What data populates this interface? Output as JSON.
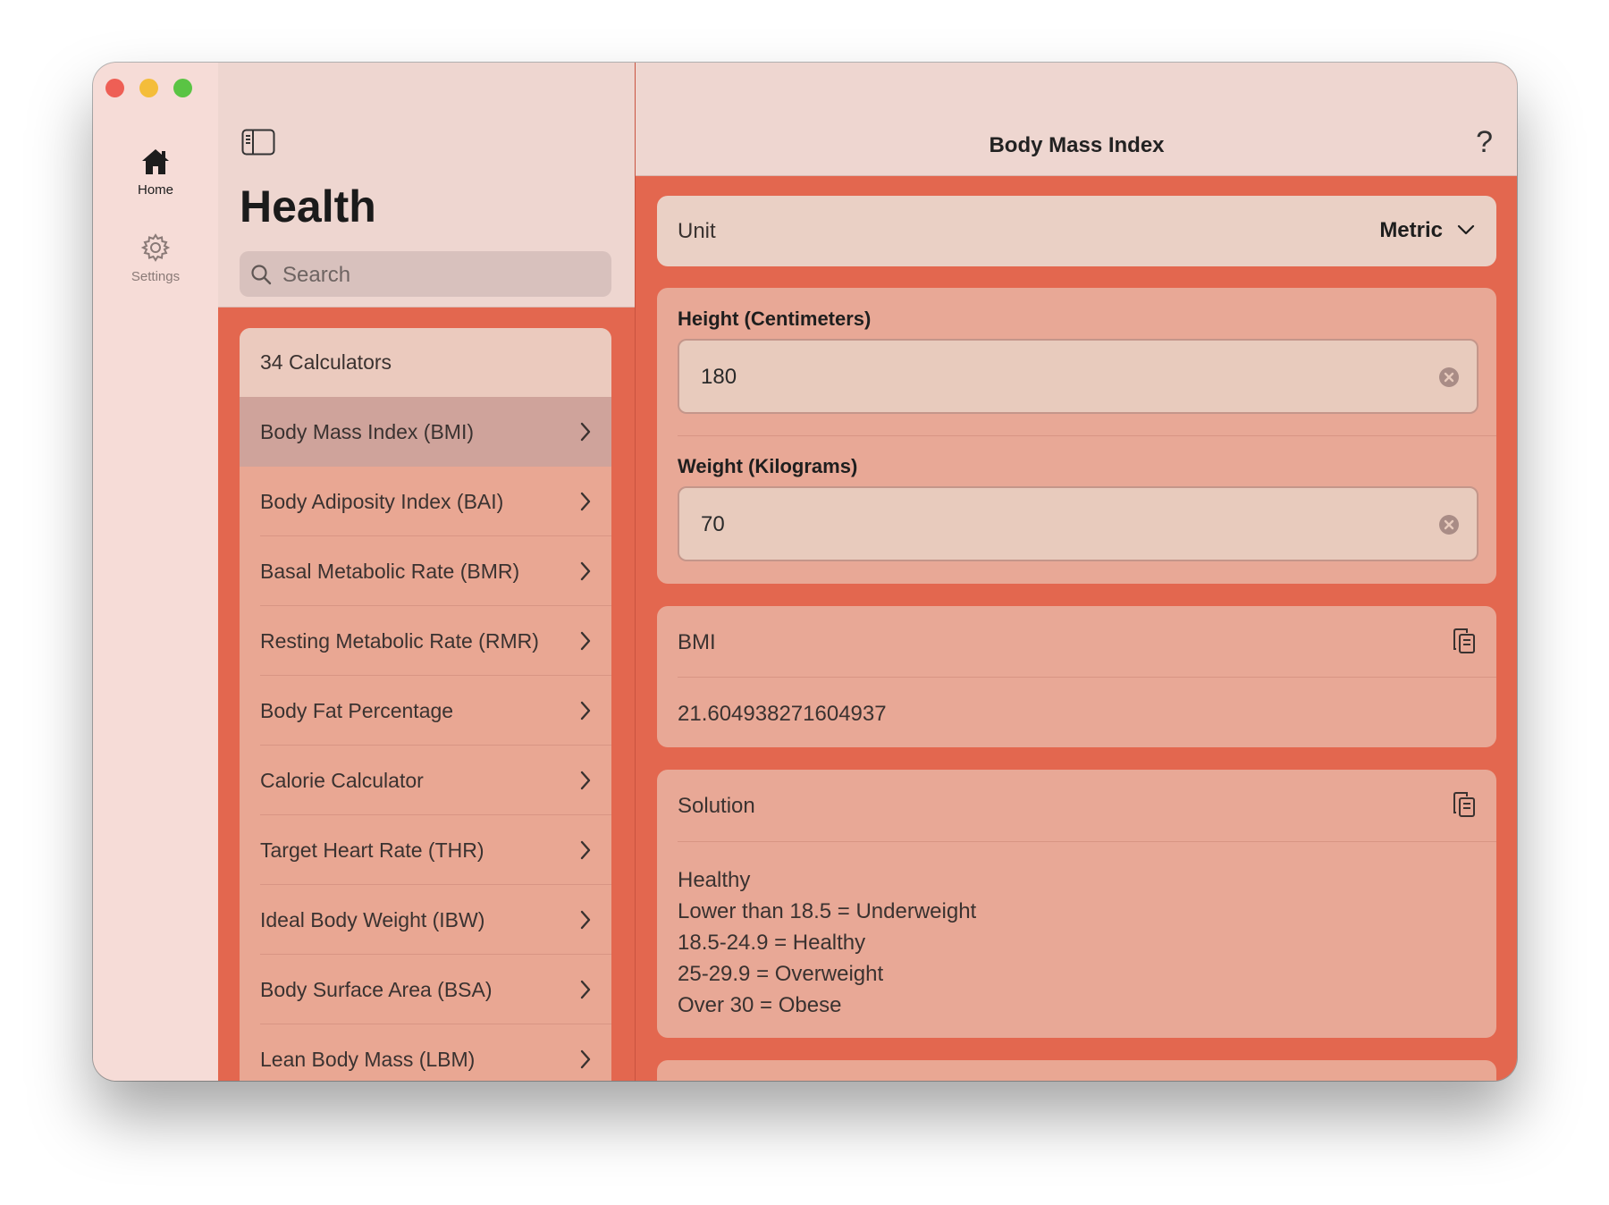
{
  "rail": {
    "home_label": "Home",
    "settings_label": "Settings"
  },
  "list": {
    "title": "Health",
    "search_placeholder": "Search",
    "count": "34 Calculators",
    "items": [
      "Body Mass Index (BMI)",
      "Body Adiposity Index (BAI)",
      "Basal Metabolic Rate (BMR)",
      "Resting Metabolic Rate (RMR)",
      "Body Fat Percentage",
      "Calorie Calculator",
      "Target Heart Rate (THR)",
      "Ideal Body Weight (IBW)",
      "Body Surface Area (BSA)",
      "Lean Body Mass (LBM)"
    ]
  },
  "detail": {
    "title": "Body Mass Index",
    "help": "?",
    "unit_label": "Unit",
    "unit_value": "Metric",
    "height_label": "Height (Centimeters)",
    "height_value": "180",
    "weight_label": "Weight (Kilograms)",
    "weight_value": "70",
    "bmi_label": "BMI",
    "bmi_value": "21.604938271604937",
    "solution_label": "Solution",
    "solution_text": "Healthy\nLower than 18.5 = Underweight\n18.5-24.9 = Healthy\n25-29.9 = Overweight\nOver 30 = Obese"
  },
  "colors": {
    "accent": "#e3674f",
    "card": "#e8a896",
    "header": "#eed6d0"
  }
}
